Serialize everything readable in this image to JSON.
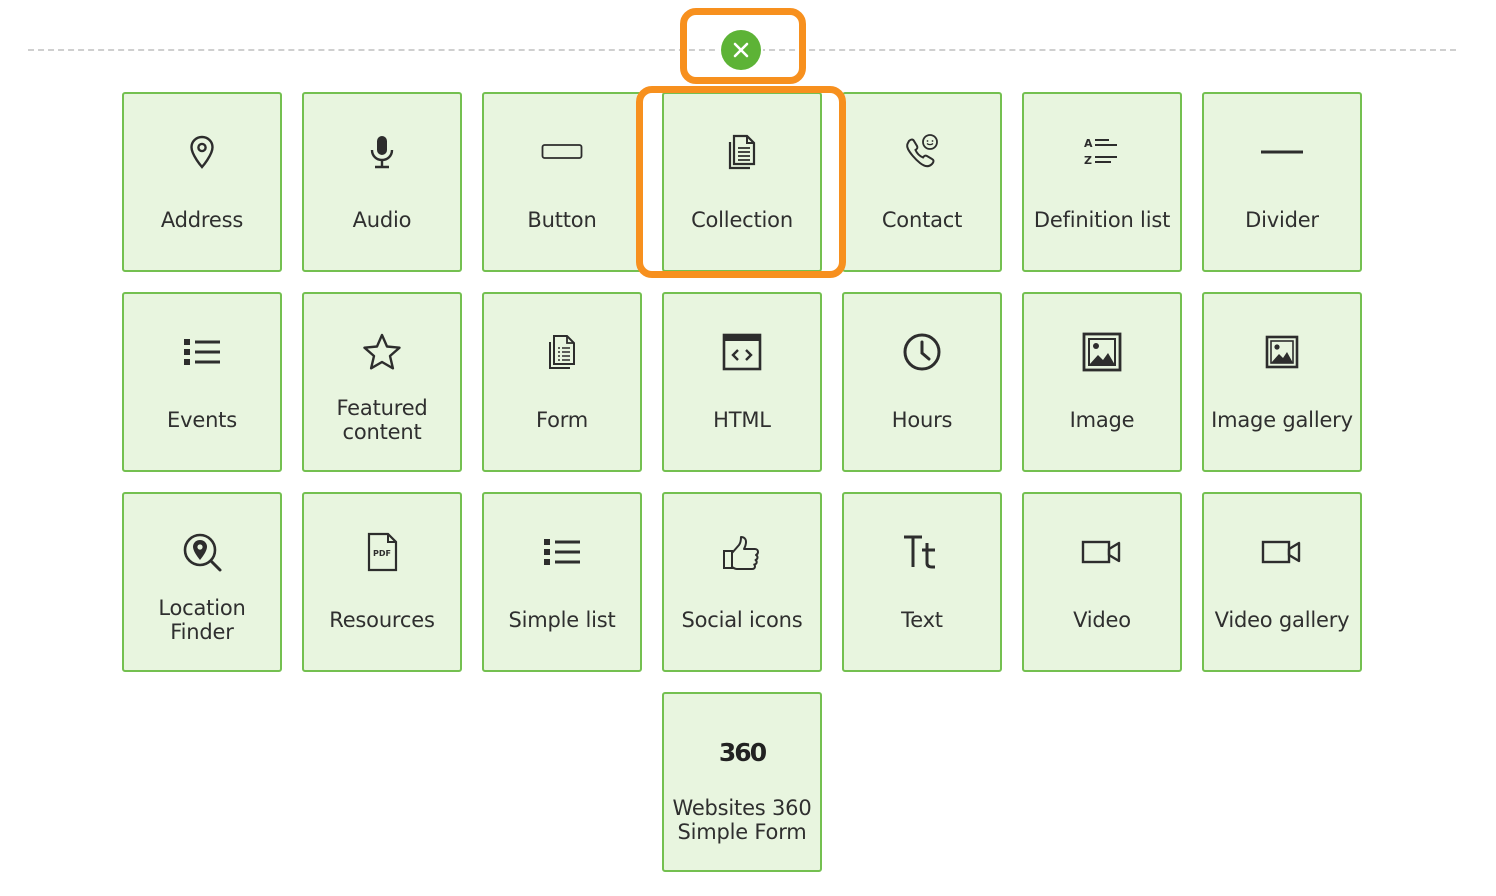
{
  "close_button": {
    "icon": "close-icon",
    "color": "#5db336"
  },
  "highlight_color": "#f7901e",
  "tile_colors": {
    "background": "#e8f5df",
    "border": "#74c050"
  },
  "tiles": [
    {
      "label": "Address",
      "icon": "map-pin-icon"
    },
    {
      "label": "Audio",
      "icon": "microphone-icon"
    },
    {
      "label": "Button",
      "icon": "button-rect-icon"
    },
    {
      "label": "Collection",
      "icon": "documents-icon"
    },
    {
      "label": "Contact",
      "icon": "phone-chat-icon"
    },
    {
      "label": "Definition list",
      "icon": "definition-list-icon"
    },
    {
      "label": "Divider",
      "icon": "horizontal-line-icon"
    },
    {
      "label": "Events",
      "icon": "bullet-list-icon"
    },
    {
      "label": "Featured\ncontent",
      "icon": "star-icon"
    },
    {
      "label": "Form",
      "icon": "form-document-icon"
    },
    {
      "label": "HTML",
      "icon": "code-window-icon"
    },
    {
      "label": "Hours",
      "icon": "clock-icon"
    },
    {
      "label": "Image",
      "icon": "image-icon"
    },
    {
      "label": "Image gallery",
      "icon": "image-small-icon"
    },
    {
      "label": "Location\nFinder",
      "icon": "location-search-icon"
    },
    {
      "label": "Resources",
      "icon": "pdf-file-icon"
    },
    {
      "label": "Simple list",
      "icon": "bullet-list-icon"
    },
    {
      "label": "Social icons",
      "icon": "thumbs-up-icon"
    },
    {
      "label": "Text",
      "icon": "text-type-icon"
    },
    {
      "label": "Video",
      "icon": "video-camera-icon"
    },
    {
      "label": "Video gallery",
      "icon": "video-camera-icon"
    },
    {
      "label": "Websites 360\nSimple Form",
      "icon": "websites-360-logo-icon",
      "logo_text": "360"
    }
  ]
}
